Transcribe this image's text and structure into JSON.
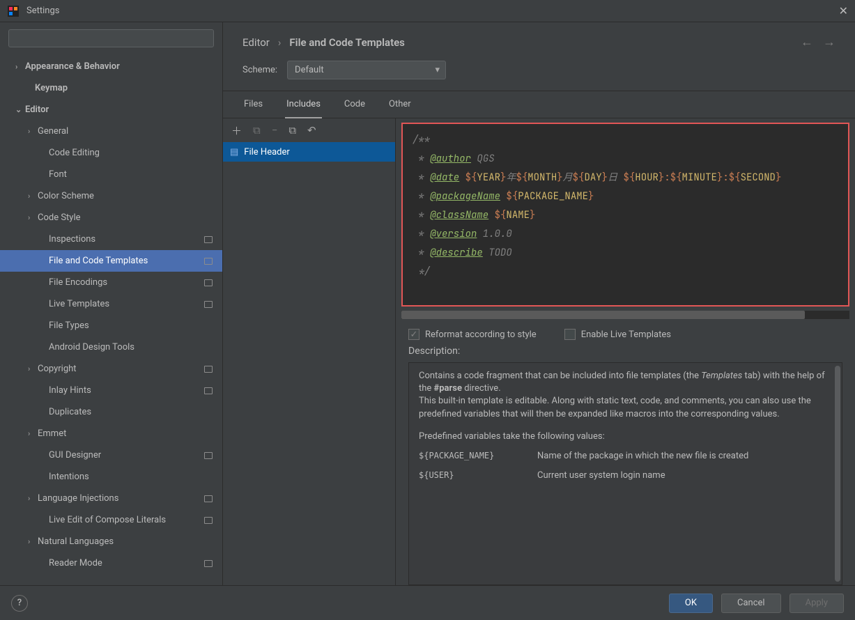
{
  "window": {
    "title": "Settings"
  },
  "sidebar": {
    "search_placeholder": "",
    "items": [
      {
        "label": "Appearance & Behavior",
        "indent": 22,
        "arrow": "›",
        "bold": true
      },
      {
        "label": "Keymap",
        "indent": 36,
        "bold": true
      },
      {
        "label": "Editor",
        "indent": 22,
        "arrow": "⌄",
        "bold": true
      },
      {
        "label": "General",
        "indent": 40,
        "arrow": "›"
      },
      {
        "label": "Code Editing",
        "indent": 56
      },
      {
        "label": "Font",
        "indent": 56
      },
      {
        "label": "Color Scheme",
        "indent": 40,
        "arrow": "›"
      },
      {
        "label": "Code Style",
        "indent": 40,
        "arrow": "›"
      },
      {
        "label": "Inspections",
        "indent": 56,
        "marker": true
      },
      {
        "label": "File and Code Templates",
        "indent": 56,
        "selected": true,
        "marker": true
      },
      {
        "label": "File Encodings",
        "indent": 56,
        "marker": true
      },
      {
        "label": "Live Templates",
        "indent": 56,
        "marker": true
      },
      {
        "label": "File Types",
        "indent": 56
      },
      {
        "label": "Android Design Tools",
        "indent": 56
      },
      {
        "label": "Copyright",
        "indent": 40,
        "arrow": "›",
        "marker": true
      },
      {
        "label": "Inlay Hints",
        "indent": 56,
        "marker": true
      },
      {
        "label": "Duplicates",
        "indent": 56
      },
      {
        "label": "Emmet",
        "indent": 40,
        "arrow": "›"
      },
      {
        "label": "GUI Designer",
        "indent": 56,
        "marker": true
      },
      {
        "label": "Intentions",
        "indent": 56
      },
      {
        "label": "Language Injections",
        "indent": 40,
        "arrow": "›",
        "marker": true
      },
      {
        "label": "Live Edit of Compose Literals",
        "indent": 56,
        "marker": true
      },
      {
        "label": "Natural Languages",
        "indent": 40,
        "arrow": "›"
      },
      {
        "label": "Reader Mode",
        "indent": 56,
        "marker": true
      }
    ]
  },
  "breadcrumb": {
    "parent": "Editor",
    "current": "File and Code Templates"
  },
  "scheme": {
    "label": "Scheme:",
    "value": "Default"
  },
  "tabs": [
    {
      "label": "Files"
    },
    {
      "label": "Includes",
      "active": true
    },
    {
      "label": "Code"
    },
    {
      "label": "Other"
    }
  ],
  "templates": {
    "toolbar_icons": [
      "add",
      "add-child",
      "remove",
      "copy",
      "revert"
    ],
    "items": [
      {
        "label": "File Header",
        "selected": true
      }
    ]
  },
  "editor": {
    "lines": [
      {
        "comment": "/**"
      },
      {
        "star": " * ",
        "tag": "@author",
        "rest": " QGS"
      },
      {
        "star": " * ",
        "tag": "@date",
        "vars": " ${YEAR}年${MONTH}月${DAY}日 ${HOUR}:${MINUTE}:${SECOND}"
      },
      {
        "star": " * ",
        "tag": "@packageName",
        "var_only": " ${PACKAGE_NAME}"
      },
      {
        "star": " * ",
        "tag": "@className",
        "var_only": " ${NAME}"
      },
      {
        "star": " * ",
        "tag": "@version",
        "rest": " 1.0.0"
      },
      {
        "star": " * ",
        "tag": "@describe",
        "rest": " TODO"
      },
      {
        "comment": " */"
      }
    ]
  },
  "options": {
    "reformat": {
      "label": "Reformat according to style",
      "checked": true
    },
    "live_templates": {
      "label": "Enable Live Templates",
      "checked": false
    }
  },
  "description": {
    "label": "Description:",
    "body1": "Contains a code fragment that can be included into file templates (the ",
    "body1_em": "Templates",
    "body1_tail": " tab) with the help of the ",
    "body1_bold": "#parse",
    "body1_end": " directive.",
    "body2": "This built-in template is editable. Along with static text, code, and comments, you can also use the predefined variables that will then be expanded like macros into the corresponding values.",
    "body3": "Predefined variables take the following values:",
    "vars": [
      {
        "name": "${PACKAGE_NAME}",
        "desc": "Name of the package in which the new file is created"
      },
      {
        "name": "${USER}",
        "desc": "Current user system login name"
      }
    ]
  },
  "footer": {
    "ok": "OK",
    "cancel": "Cancel",
    "apply": "Apply"
  }
}
